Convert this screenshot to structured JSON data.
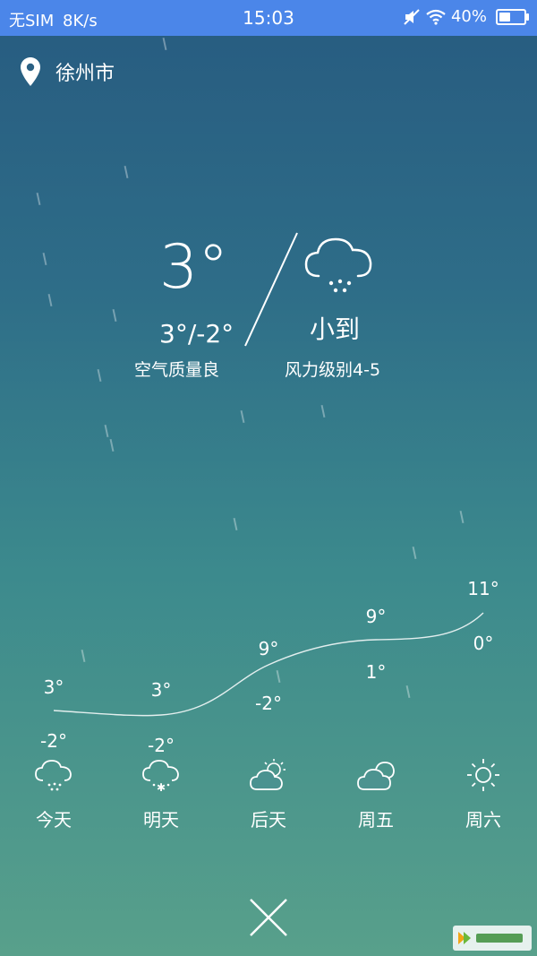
{
  "status_bar": {
    "carrier": "无SIM",
    "speed": "8K/s",
    "time": "15:03",
    "battery": "40%"
  },
  "location": {
    "city": "徐州市",
    "icon": "location-pin-icon"
  },
  "current": {
    "temp": "3°",
    "range": "3°/-2°",
    "air_quality": "空气质量良",
    "condition": "小到",
    "wind": "风力级别4-5",
    "icon": "cloud-rain-icon"
  },
  "forecast": {
    "days": [
      {
        "name": "今天",
        "high": "3°",
        "low": "-2°",
        "icon": "cloud-rain-icon"
      },
      {
        "name": "明天",
        "high": "3°",
        "low": "-2°",
        "icon": "cloud-snow-icon"
      },
      {
        "name": "后天",
        "high": "9°",
        "low": "-2°",
        "icon": "partly-cloudy-icon"
      },
      {
        "name": "周五",
        "high": "9°",
        "low": "1°",
        "icon": "cloudy-icon"
      },
      {
        "name": "周六",
        "high": "11°",
        "low": "0°",
        "icon": "sunny-icon"
      }
    ]
  },
  "colors": {
    "status_bar": "#4b86e9",
    "bg_top": "#275b80",
    "bg_bottom": "#58a08b"
  }
}
